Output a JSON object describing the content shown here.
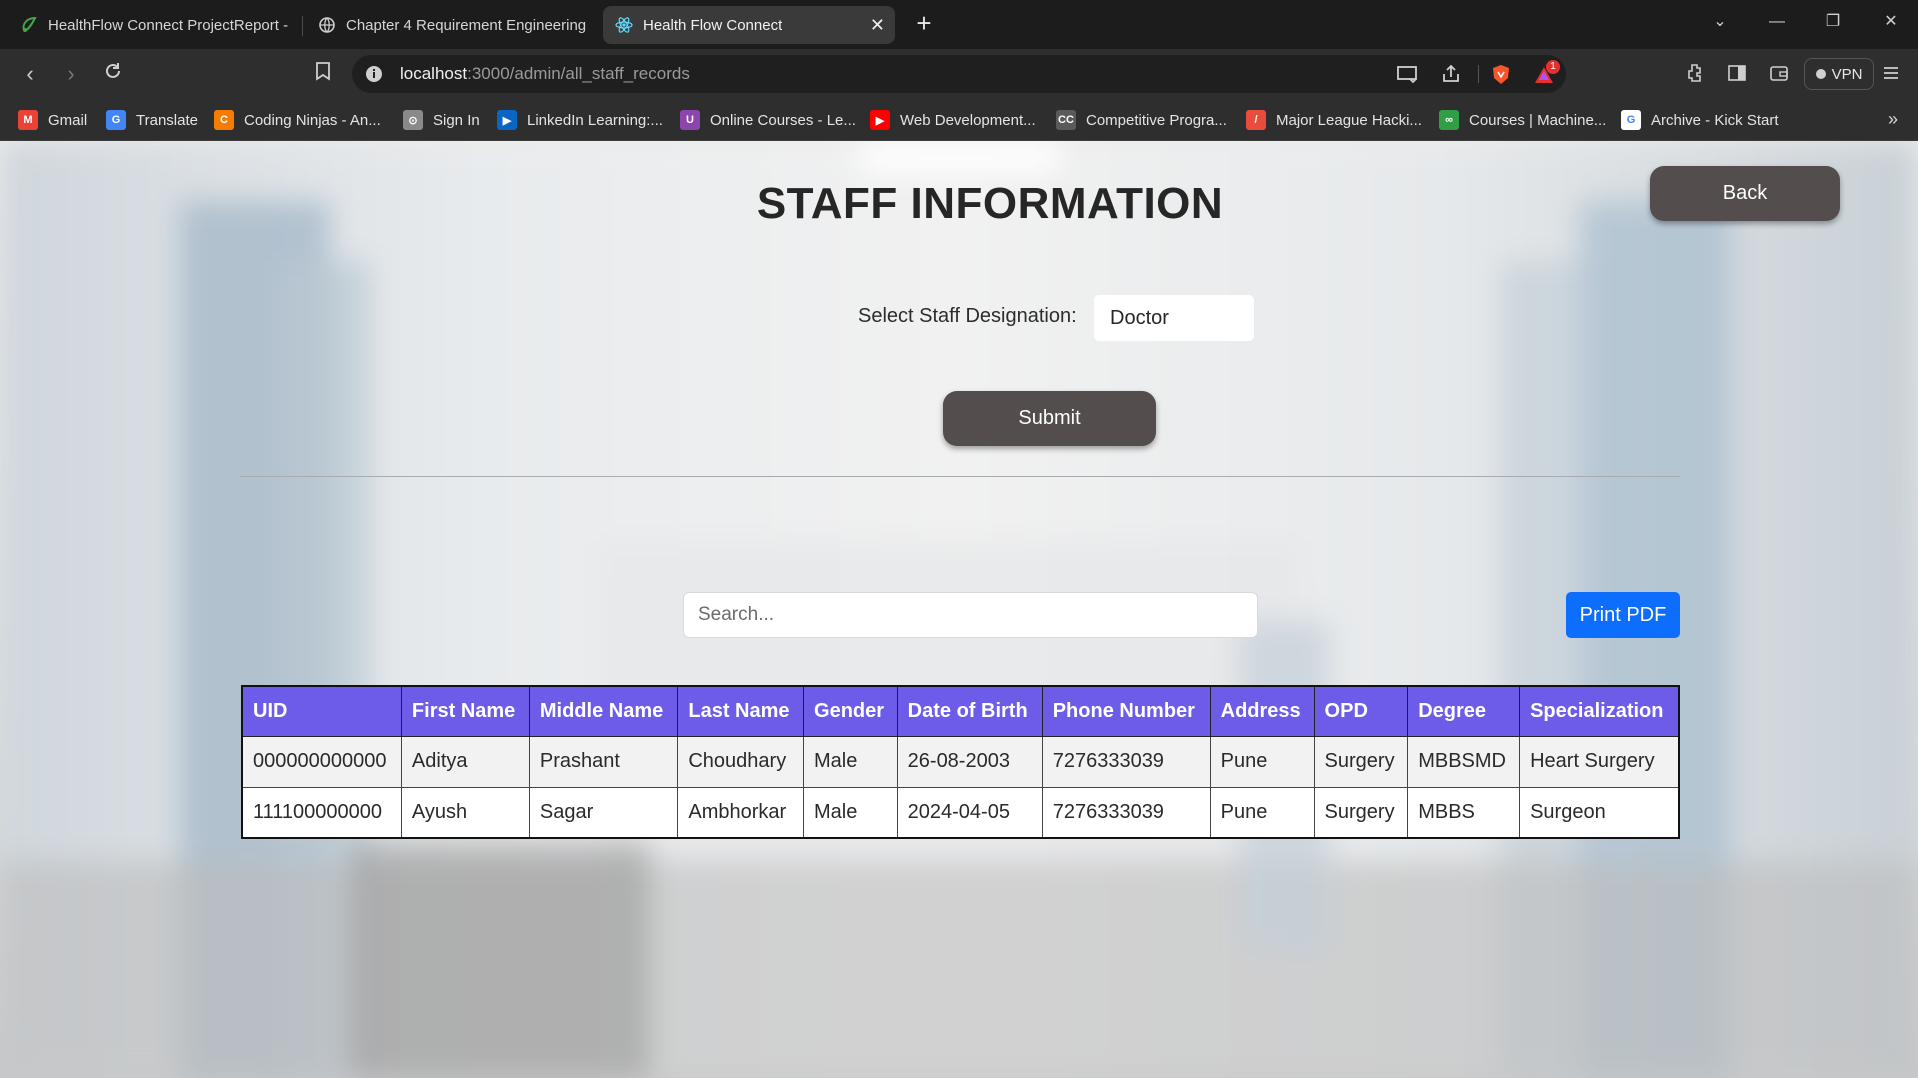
{
  "browser": {
    "tabs": [
      {
        "title": "HealthFlow Connect ProjectReport -",
        "icon": "overleaf-icon"
      },
      {
        "title": "Chapter 4 Requirement Engineering",
        "icon": "globe-icon"
      },
      {
        "title": "Health Flow Connect",
        "icon": "react-icon",
        "active": true
      }
    ],
    "url": {
      "host": "localhost",
      "path": ":3000/admin/all_staff_records"
    },
    "vpn_label": "VPN",
    "notification_count": "1",
    "bookmarks": [
      {
        "label": "Gmail",
        "color": "#ea4335",
        "glyph": "M"
      },
      {
        "label": "Translate",
        "color": "#4285f4",
        "glyph": "G"
      },
      {
        "label": "Coding Ninjas - An...",
        "color": "#f57c00",
        "glyph": "C"
      },
      {
        "label": "Sign In",
        "color": "#8a8a8a",
        "glyph": "⊙"
      },
      {
        "label": "LinkedIn Learning:...",
        "color": "#0a66c2",
        "glyph": "▶"
      },
      {
        "label": "Online Courses - Le...",
        "color": "#8e44ad",
        "glyph": "U"
      },
      {
        "label": "Web Development...",
        "color": "#ff0000",
        "glyph": "▶"
      },
      {
        "label": "Competitive Progra...",
        "color": "#5a5a5a",
        "glyph": "CC"
      },
      {
        "label": "Major League Hacki...",
        "color": "#e74c3c",
        "glyph": "/"
      },
      {
        "label": "Courses | Machine...",
        "color": "#2f9e44",
        "glyph": "∞"
      },
      {
        "label": "Archive - Kick Start",
        "color": "#ffffff",
        "glyph": "G"
      }
    ]
  },
  "page": {
    "title": "STAFF INFORMATION",
    "back_label": "Back",
    "select_label": "Select Staff Designation:",
    "selected_designation": "Doctor",
    "submit_label": "Submit",
    "search_placeholder": "Search...",
    "print_label": "Print PDF",
    "colors": {
      "accent": "#6c5ce7",
      "button_dark": "#534d4d",
      "print": "#0d6efd"
    }
  },
  "table": {
    "headers": [
      "UID",
      "First Name",
      "Middle Name",
      "Last Name",
      "Gender",
      "Date of Birth",
      "Phone Number",
      "Address",
      "OPD",
      "Degree",
      "Specialization"
    ],
    "rows": [
      [
        "000000000000",
        "Aditya",
        "Prashant",
        "Choudhary",
        "Male",
        "26-08-2003",
        "7276333039",
        "Pune",
        "Surgery",
        "MBBSMD",
        "Heart Surgery"
      ],
      [
        "111100000000",
        "Ayush",
        "Sagar",
        "Ambhorkar",
        "Male",
        "2024-04-05",
        "7276333039",
        "Pune",
        "Surgery",
        "MBBS",
        "Surgeon"
      ]
    ]
  }
}
